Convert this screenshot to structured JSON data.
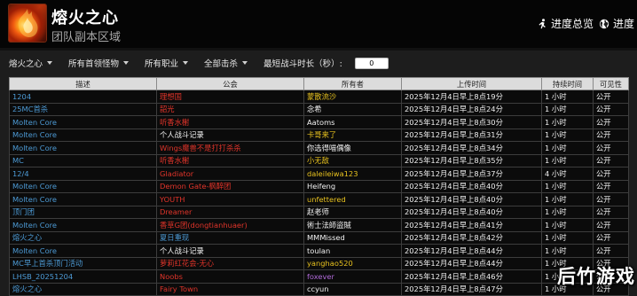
{
  "header": {
    "title": "熔火之心",
    "subtitle": "团队副本区域",
    "progress_overview_label": "进度总览",
    "progress_label": "进度"
  },
  "filters": {
    "raid": "熔火之心",
    "boss": "所有首领怪物",
    "class": "所有职业",
    "kills": "全部击杀",
    "min_duration_label": "最短战斗时长（秒）:",
    "min_duration_value": "0"
  },
  "table": {
    "columns": [
      "描述",
      "公会",
      "所有者",
      "上传时间",
      "持续时间",
      "可见性"
    ],
    "rows": [
      {
        "desc": "1204",
        "guild": "理想国",
        "guild_color": "#e0342a",
        "owner": "蒙散流沙",
        "owner_color": "#e8c21f",
        "time": "2025年12月4日早上8点19分",
        "duration": "1 小时",
        "visibility": "公开"
      },
      {
        "desc": "25MC首杀",
        "guild": "韶光",
        "guild_color": "#e0342a",
        "owner": "念希",
        "owner_color": "#f2f2f2",
        "time": "2025年12月4日早上8点24分",
        "duration": "1 小时",
        "visibility": "公开"
      },
      {
        "desc": "Molten Core",
        "guild": "听香水榭",
        "guild_color": "#e0342a",
        "owner": "Aatoms",
        "owner_color": "#f2f2f2",
        "time": "2025年12月4日早上8点30分",
        "duration": "1 小时",
        "visibility": "公开"
      },
      {
        "desc": "Molten Core",
        "guild": "个人战斗记录",
        "guild_color": "#f2f2f2",
        "owner": "卡哥来了",
        "owner_color": "#e8c21f",
        "time": "2025年12月4日早上8点31分",
        "duration": "1 小时",
        "visibility": "公开"
      },
      {
        "desc": "Molten Core",
        "guild": "Wings魔兽不是打打杀杀",
        "guild_color": "#e0342a",
        "owner": "你选得喵偶像",
        "owner_color": "#f2f2f2",
        "time": "2025年12月4日早上8点34分",
        "duration": "1 小时",
        "visibility": "公开"
      },
      {
        "desc": "MC",
        "guild": "听香水榭",
        "guild_color": "#e0342a",
        "owner": "小无敌",
        "owner_color": "#e8c21f",
        "time": "2025年12月4日早上8点35分",
        "duration": "1 小时",
        "visibility": "公开"
      },
      {
        "desc": "12/4",
        "guild": "Gladiator",
        "guild_color": "#e0342a",
        "owner": "daleileiwa123",
        "owner_color": "#e8c21f",
        "time": "2025年12月4日早上8点37分",
        "duration": "4 小时",
        "visibility": "公开"
      },
      {
        "desc": "Molten Core",
        "guild": "Demon Gate-枫醉团",
        "guild_color": "#e0342a",
        "owner": "Heifeng",
        "owner_color": "#f2f2f2",
        "time": "2025年12月4日早上8点40分",
        "duration": "1 小时",
        "visibility": "公开"
      },
      {
        "desc": "Molten Core",
        "guild": "YOUTH",
        "guild_color": "#e0342a",
        "owner": "unfettered",
        "owner_color": "#e8c21f",
        "time": "2025年12月4日早上8点40分",
        "duration": "1 小时",
        "visibility": "公开"
      },
      {
        "desc": "顶门团",
        "guild": "Dreamer",
        "guild_color": "#e0342a",
        "owner": "赵老师",
        "owner_color": "#f2f2f2",
        "time": "2025年12月4日早上8点40分",
        "duration": "1 小时",
        "visibility": "公开"
      },
      {
        "desc": "Molten Core",
        "guild": "香草G团(dongtianhuaer)",
        "guild_color": "#e0342a",
        "owner": "術士法師盜賊",
        "owner_color": "#f2f2f2",
        "time": "2025年12月4日早上8点41分",
        "duration": "1 小时",
        "visibility": "公开"
      },
      {
        "desc": "熔火之心",
        "guild": "夏日重现",
        "guild_color": "#4d9bd6",
        "owner": "MMMissed",
        "owner_color": "#f2f2f2",
        "time": "2025年12月4日早上8点42分",
        "duration": "1 小时",
        "visibility": "公开"
      },
      {
        "desc": "Molten Core",
        "guild": "个人战斗记录",
        "guild_color": "#f2f2f2",
        "owner": "toulan",
        "owner_color": "#f2f2f2",
        "time": "2025年12月4日早上8点44分",
        "duration": "1 小时",
        "visibility": "公开"
      },
      {
        "desc": "MC早上首杀顶门活动",
        "guild": "萝莉红花会-无心",
        "guild_color": "#e0342a",
        "owner": "yanghao520",
        "owner_color": "#e8c21f",
        "time": "2025年12月4日早上8点44分",
        "duration": "1 小时",
        "visibility": "公开"
      },
      {
        "desc": "LHSB_20251204",
        "guild": "Noobs",
        "guild_color": "#e0342a",
        "owner": "foxever",
        "owner_color": "#b06ad8",
        "time": "2025年12月4日早上8点46分",
        "duration": "1 小时",
        "visibility": "公开"
      },
      {
        "desc": "熔火之心",
        "guild": "Fairy Town",
        "guild_color": "#e0342a",
        "owner": "ccyun",
        "owner_color": "#f2f2f2",
        "time": "2025年12月4日早上8点47分",
        "duration": "1 小时",
        "visibility": "公开"
      }
    ]
  },
  "watermark": "后竹游戏",
  "icons": {
    "boss": "fire-lord-icon",
    "progress_overview": "running-figure-icon",
    "progress": "globe-icon"
  }
}
